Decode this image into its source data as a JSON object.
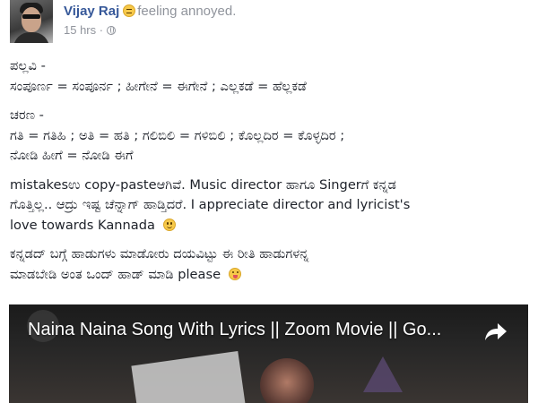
{
  "post": {
    "author": "Vijay Raj",
    "feeling_icon": "annoyed-face-emoji",
    "feeling_text": "feeling annoyed.",
    "time": "15 hrs",
    "separator": "·",
    "privacy_icon": "globe-icon"
  },
  "body": {
    "pallavi_lines": [
      "ಪಲ್ಲವಿ -",
      "ಸಂಪೂರ್ಣ = ಸಂಪೂರ್ನ ; ಹೀಗೇನೆ = ಈಗೇನೆ ; ಎಲ್ಲಕಡೆ = ಹೆಲ್ಲಕಡೆ"
    ],
    "charana_lines": [
      "ಚರಣ -",
      "ಗತಿ = ಗತಿಹಿ ; ಅತಿ = ಹತಿ ; ಗಲಿಬಿಲಿ = ಗಳಿಬಿಲಿ ; ಕೊಲ್ಲದಿರ = ಕೊಳ್ಳದಿರ ;",
      "ನೋಡಿ ಹೀಗೆ = ನೋಡಿ ಈಗೆ"
    ],
    "mistakes_lines": [
      "mistakesಉ copy-pasteಆಗಿವೆ. Music director ಹಾಗೂ Singerಗೆ ಕನ್ನಡ",
      "ಗೊತ್ತಿಲ್ಲ.. ಆದ್ರು ಇಷ್ಟ ಚೆನ್ನಾಗ್ ಹಾಡ್ತಿದರೆ. I appreciate director and lyricist's",
      "love towards Kannada"
    ],
    "mistakes_emoji": "smile-emoji",
    "request_lines": [
      "ಕನ್ನಡದ್ ಬಗ್ಗೆ ಹಾಡುಗಳು ಮಾಡೋರು ದಯವಿಟ್ಟು ಈ ರೀತಿ ಹಾಡುಗಳನ್ನ",
      "ಮಾಡಬೇಡಿ ಅಂತ ಒಂದ್ ಹಾಡ್ ಮಾಡಿ please"
    ],
    "request_emoji": "tongue-out-emoji"
  },
  "video": {
    "title": "Naina Naina Song With Lyrics || Zoom Movie || Go...",
    "share_icon": "share-arrow-icon"
  },
  "colors": {
    "link": "#365899",
    "meta": "#90949c",
    "text": "#1d2129"
  }
}
